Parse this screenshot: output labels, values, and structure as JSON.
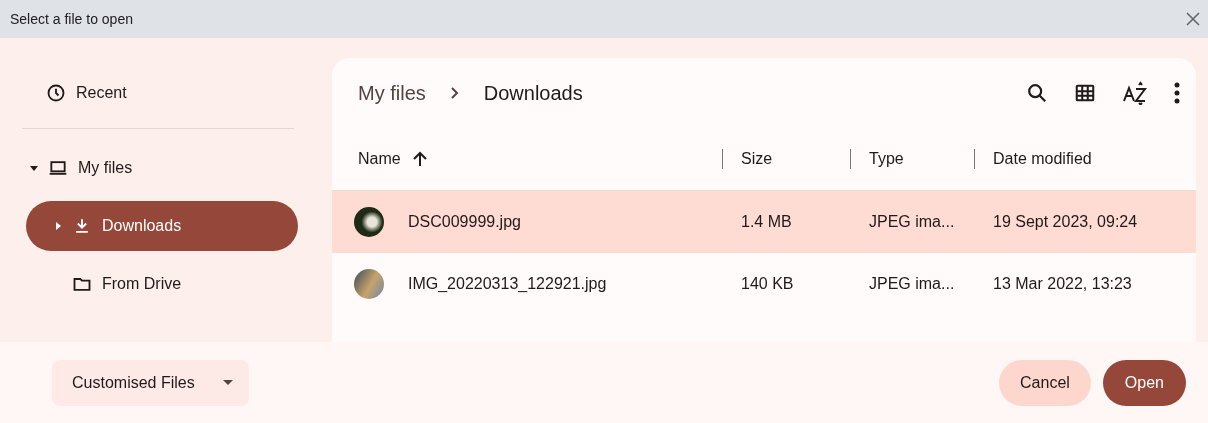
{
  "window": {
    "title": "Select a file to open"
  },
  "sidebar": {
    "items": [
      {
        "label": "Recent",
        "kind": "recent",
        "selected": false
      },
      {
        "label": "My files",
        "kind": "computer",
        "selected": false,
        "expanded": true,
        "children": [
          {
            "label": "Downloads",
            "kind": "download",
            "selected": true,
            "expanded": false
          },
          {
            "label": "From Drive",
            "kind": "folder",
            "selected": false
          }
        ]
      }
    ]
  },
  "breadcrumb": [
    "My files",
    "Downloads"
  ],
  "table": {
    "columns": [
      {
        "label": "Name",
        "sorted": true
      },
      {
        "label": "Size",
        "sorted": false
      },
      {
        "label": "Type",
        "sorted": false
      },
      {
        "label": "Date modified",
        "sorted": false
      }
    ],
    "rows": [
      {
        "name": "DSC009999.jpg",
        "size": "1.4 MB",
        "type": "JPEG ima...",
        "date": "19 Sept 2023, 09:24",
        "selected": true
      },
      {
        "name": "IMG_20220313_122921.jpg",
        "size": "140 KB",
        "type": "JPEG ima...",
        "date": "13 Mar 2022, 13:23",
        "selected": false
      }
    ]
  },
  "footer": {
    "filter": "Customised Files",
    "buttons": [
      {
        "label": "Cancel",
        "kind": "secondary"
      },
      {
        "label": "Open",
        "kind": "primary"
      }
    ]
  }
}
